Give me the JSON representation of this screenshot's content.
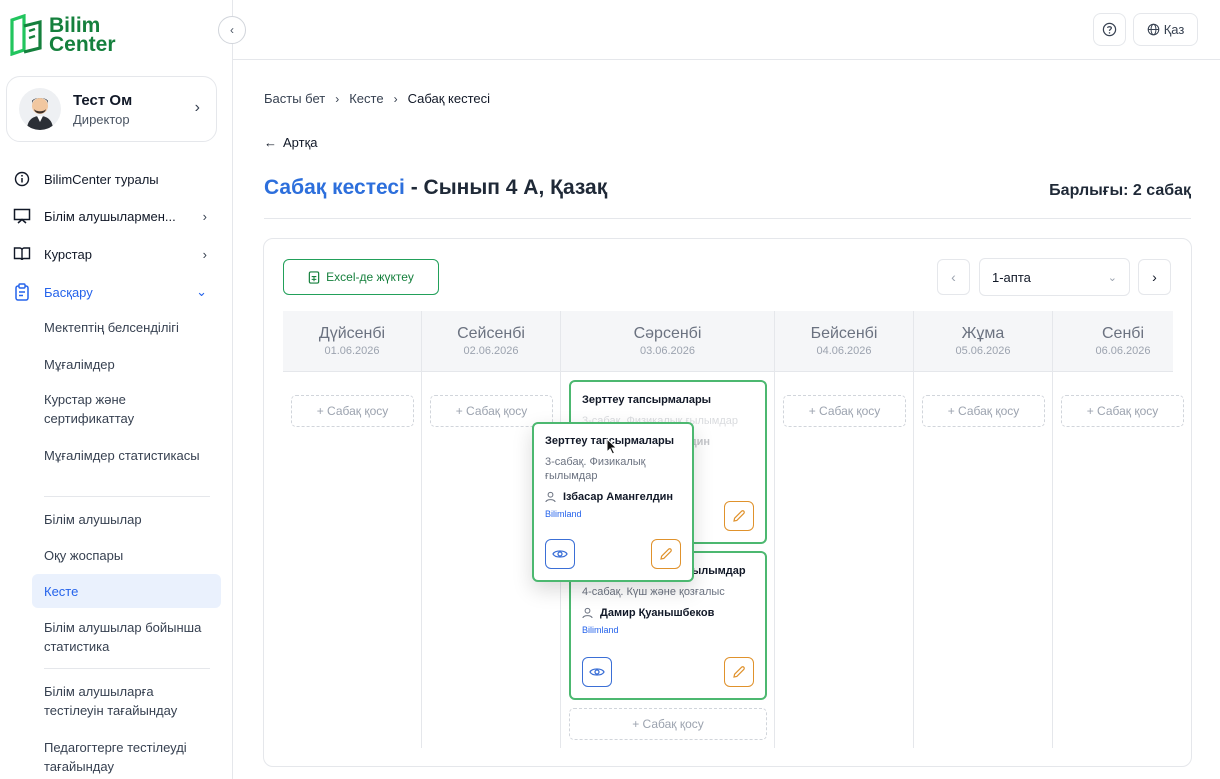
{
  "app": {
    "logo_line1": "Bilim",
    "logo_line2": "Center",
    "brand_color": "#15803d"
  },
  "profile": {
    "name": "Тест Ом",
    "role": "Директор"
  },
  "sidebar": {
    "items": [
      {
        "label": "BilimCenter туралы",
        "icon": "info-icon"
      },
      {
        "label": "Білім алушылармен...",
        "icon": "screen-icon"
      },
      {
        "label": "Курстар",
        "icon": "book-icon"
      },
      {
        "label": "Басқару",
        "icon": "clipboard-icon"
      }
    ],
    "sub_items": [
      "Мектептің белсенділігі",
      "Мұғалімдер",
      "Курстар және сертификаттау",
      "Мұғалімдер статистикасы",
      "Білім алушылар",
      "Оқу жоспары",
      "Кесте",
      "Білім алушылар бойынша статистика",
      "Білім алушыларға тестілеуін тағайындау",
      "Педагогтерге тестілеуді тағайындау"
    ]
  },
  "topbar": {
    "lang": "Қаз"
  },
  "breadcrumb": [
    "Басты бет",
    "Кесте",
    "Сабақ кестесі"
  ],
  "back": "Артқа",
  "title": {
    "highlight": "Сабақ кестесі",
    "rest": " - Сынып 4 А, Қазақ"
  },
  "total": "Барлығы: 2 сабақ",
  "toolbar": {
    "excel": "Excel-де жүктеу",
    "week": "1-апта"
  },
  "days": [
    {
      "name": "Дүйсенбі",
      "date": "01.06.2026"
    },
    {
      "name": "Сейсенбі",
      "date": "02.06.2026"
    },
    {
      "name": "Сәрсенбі",
      "date": "03.06.2026"
    },
    {
      "name": "Бейсенбі",
      "date": "04.06.2026"
    },
    {
      "name": "Жұма",
      "date": "05.06.2026"
    },
    {
      "name": "Сенбі",
      "date": "06.06.2026"
    }
  ],
  "add_lesson": "+ Сабақ қосу",
  "lessons": [
    {
      "title": "Зерттеу тапсырмалары",
      "sub": "3-сабақ. Физикалық ғылымдар",
      "teacher": "Ізбасар Амангелдин",
      "provider": "Bilimland"
    },
    {
      "title": "TIMSS: Физикалық ғылымдар",
      "sub": "4-сабақ. Күш және қозғалыс",
      "teacher": "Дамир Қуанышбеков",
      "provider": "Bilimland"
    }
  ],
  "colors": {
    "accent_blue": "#2d6fdc",
    "lesson_border": "#4cb870",
    "edit_orange": "#e0922c"
  }
}
